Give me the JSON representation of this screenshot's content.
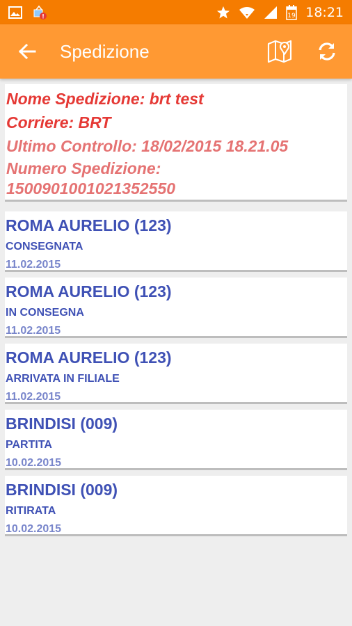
{
  "status_bar": {
    "time": "18:21",
    "calendar_day": "19",
    "icons": [
      "image-icon",
      "sync-alert-icon",
      "star-icon",
      "wifi-icon",
      "signal-icon",
      "calendar-icon"
    ]
  },
  "toolbar": {
    "title": "Spedizione",
    "back_icon": "arrow-back-icon",
    "actions": [
      "map-icon",
      "refresh-icon"
    ]
  },
  "shipment": {
    "name": "Nome Spedizione: brt test",
    "carrier": "Corriere: BRT",
    "last_check": "Ultimo Controllo: 18/02/2015 18.21.05",
    "number_label": "Numero Spedizione:",
    "number": "15009010010213525​50"
  },
  "events": [
    {
      "place": "ROMA AURELIO (123)",
      "status": "CONSEGNATA",
      "date": "11.02.2015"
    },
    {
      "place": "ROMA AURELIO (123)",
      "status": "IN CONSEGNA",
      "date": "11.02.2015"
    },
    {
      "place": "ROMA AURELIO (123)",
      "status": "ARRIVATA IN FILIALE",
      "date": "11.02.2015"
    },
    {
      "place": "BRINDISI (009)",
      "status": "PARTITA",
      "date": "10.02.2015"
    },
    {
      "place": "BRINDISI (009)",
      "status": "RITIRATA",
      "date": "10.02.2015"
    }
  ],
  "colors": {
    "status_bar": "#f57c00",
    "toolbar": "#ff9933",
    "header_text": "#e53935",
    "header_text_light": "#e57373",
    "event_place": "#3f51b5",
    "event_date": "#7986cb"
  }
}
